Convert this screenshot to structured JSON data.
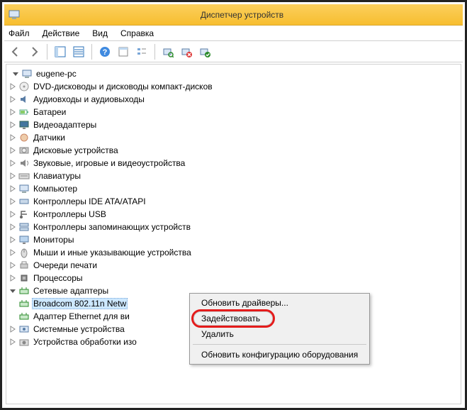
{
  "title": "Диспетчер устройств",
  "menu": {
    "file": "Файл",
    "action": "Действие",
    "view": "Вид",
    "help": "Справка"
  },
  "root": "eugene-pc",
  "categories": [
    {
      "label": "DVD-дисководы и дисководы компакт-дисков",
      "icon": "disc"
    },
    {
      "label": "Аудиовходы и аудиовыходы",
      "icon": "audio"
    },
    {
      "label": "Батареи",
      "icon": "battery"
    },
    {
      "label": "Видеоадаптеры",
      "icon": "display"
    },
    {
      "label": "Датчики",
      "icon": "sensor"
    },
    {
      "label": "Дисковые устройства",
      "icon": "hdd"
    },
    {
      "label": "Звуковые, игровые и видеоустройства",
      "icon": "sound"
    },
    {
      "label": "Клавиатуры",
      "icon": "keyboard"
    },
    {
      "label": "Компьютер",
      "icon": "computer"
    },
    {
      "label": "Контроллеры IDE ATA/ATAPI",
      "icon": "ide"
    },
    {
      "label": "Контроллеры USB",
      "icon": "usb"
    },
    {
      "label": "Контроллеры запоминающих устройств",
      "icon": "storage"
    },
    {
      "label": "Мониторы",
      "icon": "monitor"
    },
    {
      "label": "Мыши и иные указывающие устройства",
      "icon": "mouse"
    },
    {
      "label": "Очереди печати",
      "icon": "printer"
    },
    {
      "label": "Процессоры",
      "icon": "cpu"
    }
  ],
  "network": {
    "label": "Сетевые адаптеры",
    "children": [
      {
        "label": "Broadcom 802.11n Netw",
        "icon": "net",
        "selected": true
      },
      {
        "label": "Адаптер Ethernet для ви",
        "icon": "net"
      }
    ]
  },
  "after": [
    {
      "label": "Системные устройства",
      "icon": "system"
    },
    {
      "label": "Устройства обработки изо",
      "icon": "imaging"
    }
  ],
  "context": {
    "update": "Обновить драйверы...",
    "enable": "Задействовать",
    "delete": "Удалить",
    "refresh": "Обновить конфигурацию оборудования"
  },
  "icons": {
    "back": "arrow-left",
    "forward": "arrow-right",
    "up": "panel-up",
    "detail": "panel-detail",
    "help": "help",
    "props": "props",
    "list": "list",
    "scan": "scan",
    "disable": "disable",
    "enable": "enable"
  }
}
